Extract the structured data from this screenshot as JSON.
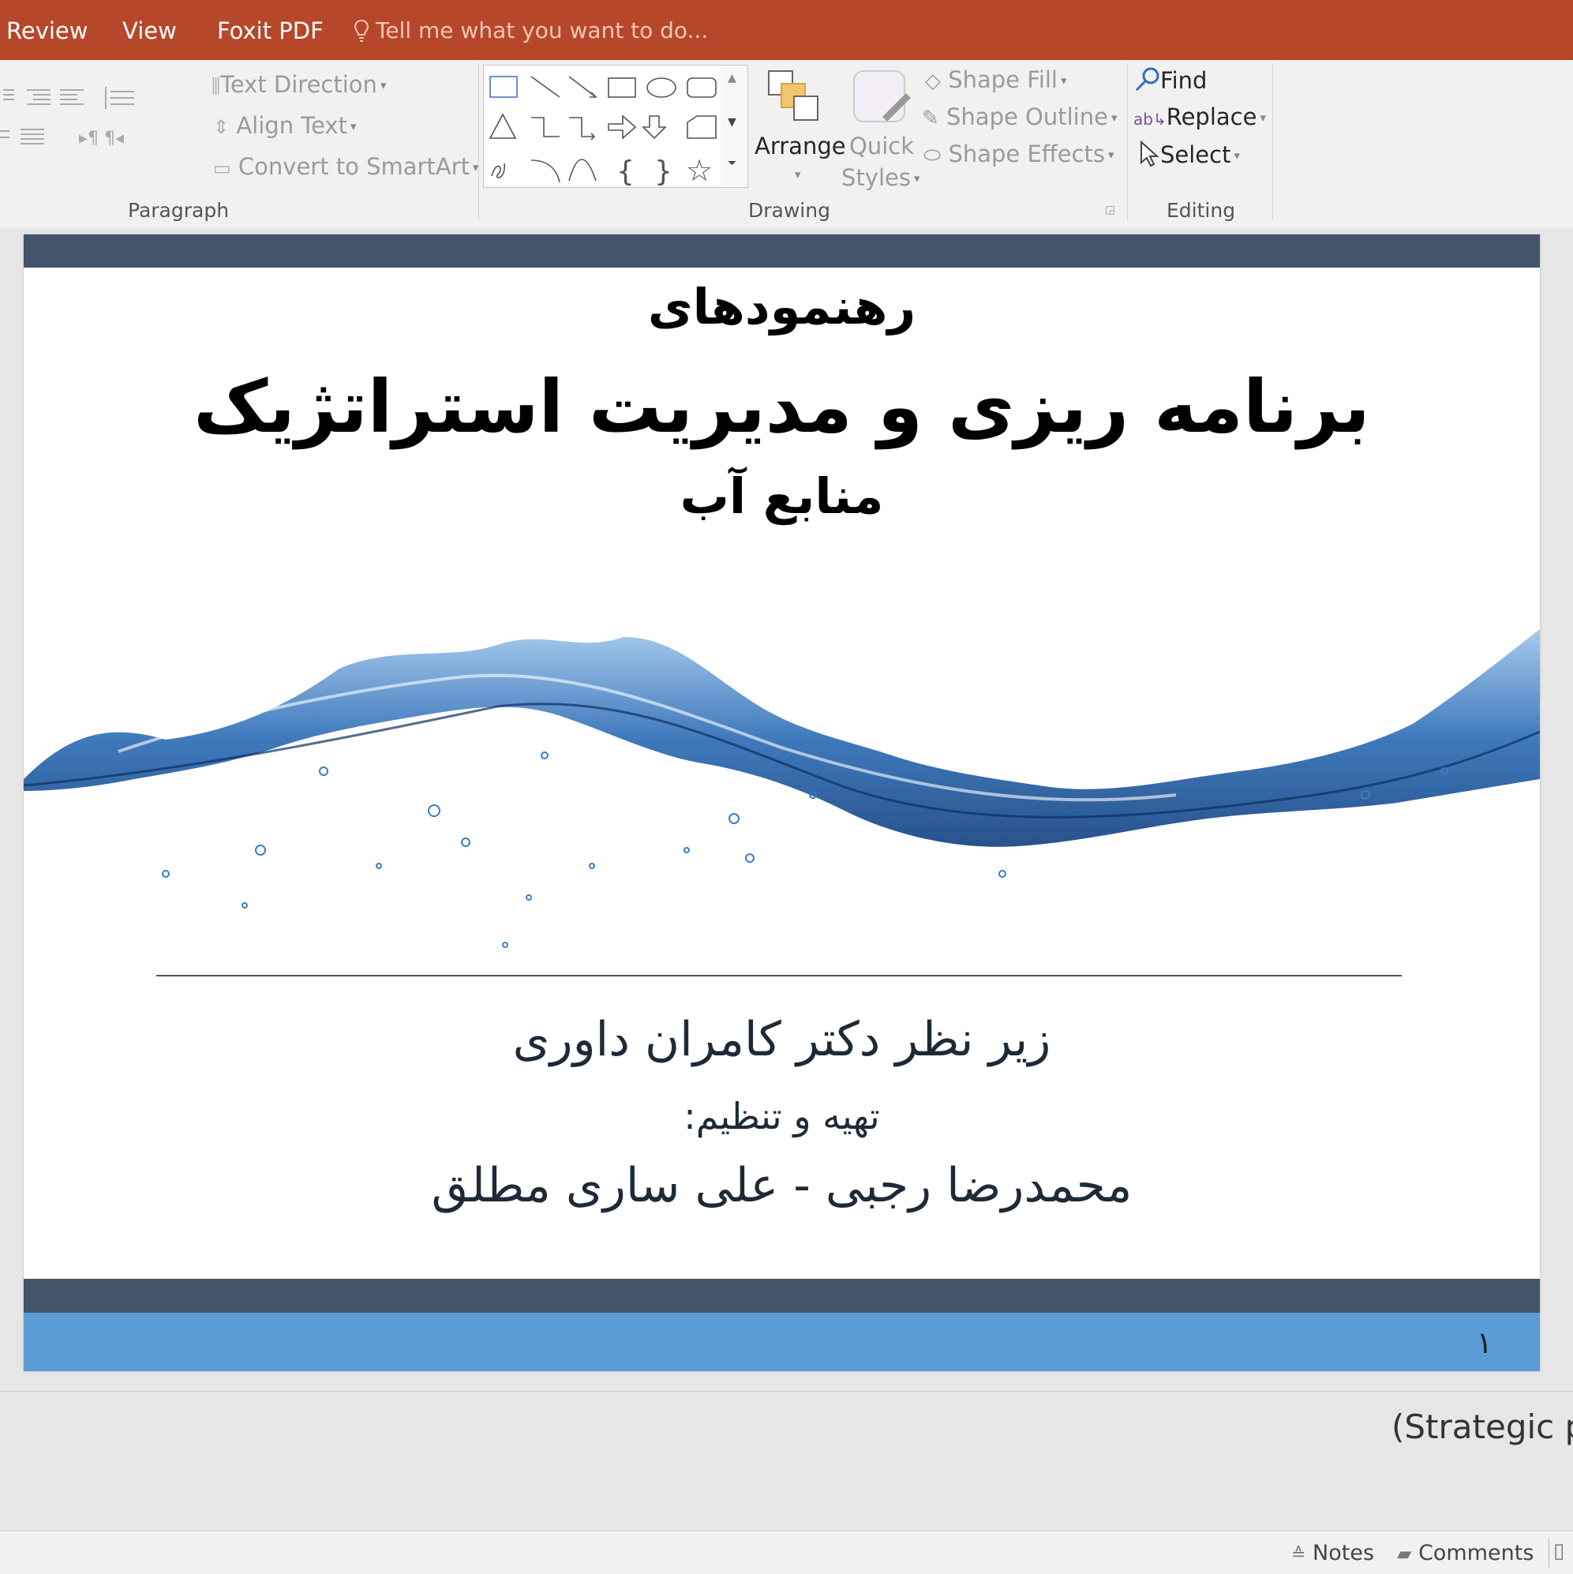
{
  "menubar": {
    "tabs": [
      "Review",
      "View",
      "Foxit PDF"
    ],
    "tell_me_placeholder": "Tell me what you want to do..."
  },
  "ribbon": {
    "paragraph": {
      "label": "Paragraph",
      "text_direction": "Text Direction",
      "align_text": "Align Text",
      "convert_smartart": "Convert to SmartArt"
    },
    "drawing": {
      "label": "Drawing",
      "arrange": "Arrange",
      "quick_styles_line1": "Quick",
      "quick_styles_line2": "Styles",
      "shape_fill": "Shape Fill",
      "shape_outline": "Shape Outline",
      "shape_effects": "Shape Effects"
    },
    "editing": {
      "label": "Editing",
      "find": "Find",
      "replace": "Replace",
      "select": "Select"
    }
  },
  "slide": {
    "title_line1": "رهنمودهای",
    "title_line2": "برنامه ریزی و مدیریت استراتژیک",
    "title_line3": "منابع آب",
    "supervisor": "زیر نظر دکتر کامران داوری",
    "prepared_by_label": "تهیه و تنظیم:",
    "authors": "محمدرضا رجبی - علی ساری مطلق",
    "slide_number": "۱",
    "colors": {
      "dark_band": "#44546a",
      "blue_band": "#5b9bd5",
      "water": "#1f5fa8"
    }
  },
  "notes": {
    "text": "(Strategic p"
  },
  "statusbar": {
    "notes": "Notes",
    "comments": "Comments"
  }
}
